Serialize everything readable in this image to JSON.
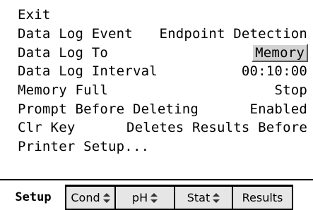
{
  "menu": {
    "items": [
      {
        "label": "Exit",
        "value": ""
      },
      {
        "label": "Data Log Event",
        "value": "Endpoint Detection"
      },
      {
        "label": "Data Log To",
        "value": "Memory"
      },
      {
        "label": "Data Log Interval",
        "value": "00:10:00"
      },
      {
        "label": "Memory Full",
        "value": "Stop"
      },
      {
        "label": "Prompt Before Deleting",
        "value": "Enabled"
      },
      {
        "label": "Clr Key",
        "value": "Deletes Results Before"
      },
      {
        "label": "Printer Setup...",
        "value": ""
      }
    ]
  },
  "tabs": [
    {
      "label": "Setup",
      "active": true
    },
    {
      "label": "Cond",
      "icon": "up-down-arrows-icon"
    },
    {
      "label": "pH",
      "icon": "up-down-arrows-icon"
    },
    {
      "label": "Stat",
      "icon": "up-down-arrows-icon"
    },
    {
      "label": "Results"
    }
  ],
  "colors": {
    "background": "#ffffff",
    "text": "#000000",
    "selected_value_bg": "#d2d2d2",
    "inactive_tab_bg": "#e6e6e6"
  }
}
